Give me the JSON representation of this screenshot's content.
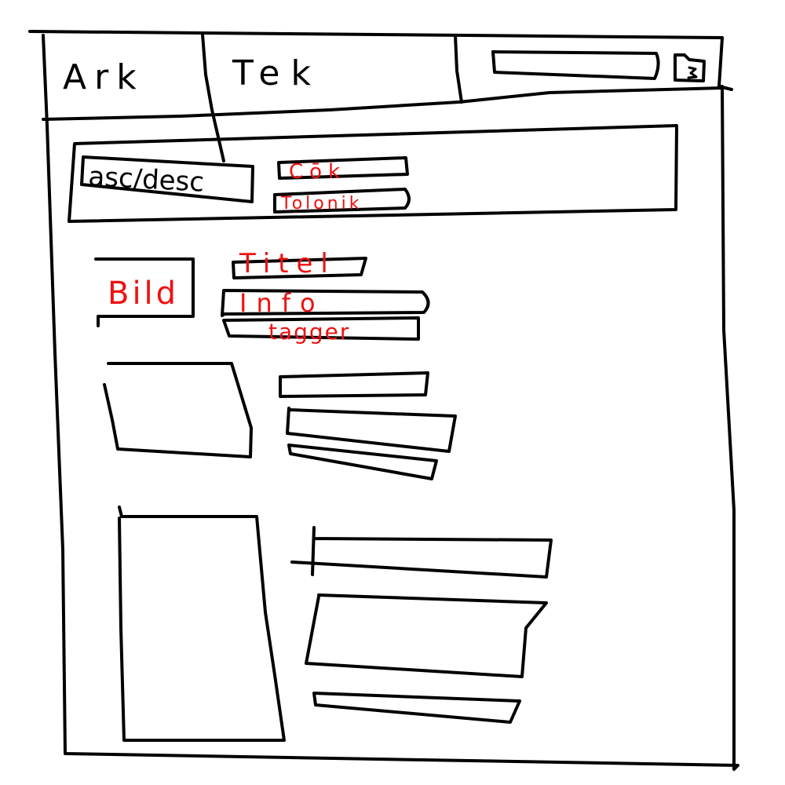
{
  "header": {
    "brand_left": "Ark",
    "brand_right": "Tek",
    "search": {
      "value": "",
      "placeholder": ""
    },
    "search_icon": "folder-search-icon"
  },
  "toolbar": {
    "sort_label": "asc/desc",
    "filter_1": "Cōk",
    "filter_2": "Tolonik"
  },
  "items": [
    {
      "image_label": "Bild",
      "title": "Titel",
      "info": "Info",
      "tags": "tagger"
    },
    {
      "image_label": "",
      "title": "",
      "info": "",
      "tags": ""
    },
    {
      "image_label": "",
      "title": "",
      "info": "",
      "tags": ""
    }
  ],
  "colors": {
    "ink": "#000000",
    "annotation": "#ee1111",
    "background": "#ffffff"
  }
}
